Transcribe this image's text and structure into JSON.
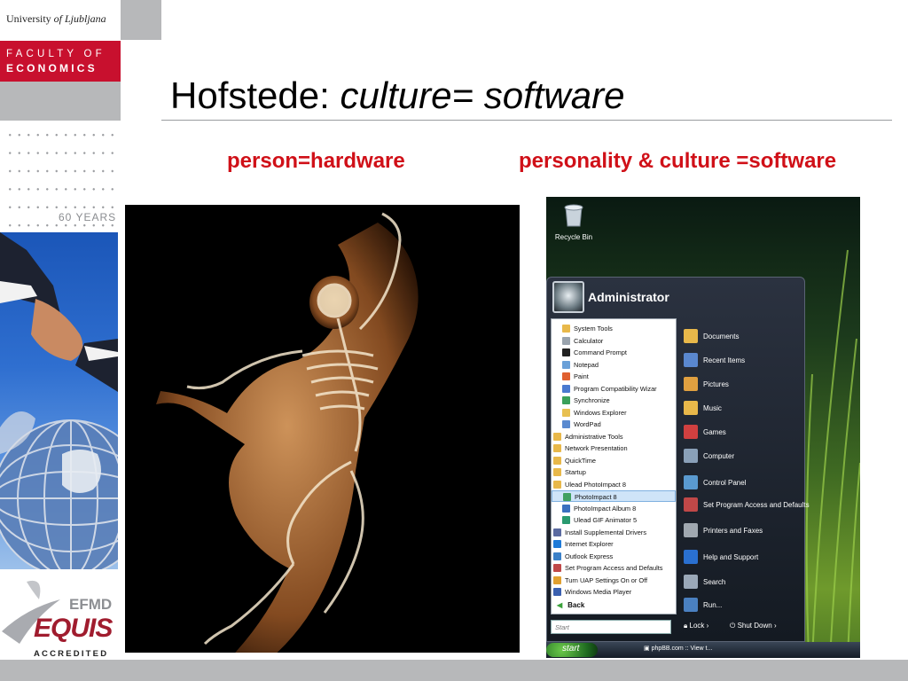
{
  "branding": {
    "university_prefix": "University",
    "university_name": "of Ljubljana",
    "faculty_line1": "FACULTY OF",
    "faculty_line2": "ECONOMICS",
    "anniversary": "60 YEARS",
    "accreditation_org": "EFMD",
    "accreditation_name": "EQUIS",
    "accreditation_status": "ACCREDITED",
    "brand_red": "#c8102e",
    "brand_grey": "#b7b8ba"
  },
  "slide": {
    "title_plain": "Hofstede: ",
    "title_italic": "culture= software",
    "left_heading": "person=hardware",
    "right_heading": "personality & culture =software",
    "heading_color": "#d01018"
  },
  "desktop": {
    "recycle_bin_label": "Recycle Bin",
    "user_name": "Administrator",
    "left_items": [
      {
        "label": "System Tools",
        "icon": "folder-icon",
        "indent": true
      },
      {
        "label": "Calculator",
        "icon": "calculator-icon",
        "indent": true
      },
      {
        "label": "Command Prompt",
        "icon": "terminal-icon",
        "indent": true
      },
      {
        "label": "Notepad",
        "icon": "notepad-icon",
        "indent": true
      },
      {
        "label": "Paint",
        "icon": "paint-icon",
        "indent": true
      },
      {
        "label": "Program Compatibility Wizar",
        "icon": "wizard-icon",
        "indent": true
      },
      {
        "label": "Synchronize",
        "icon": "sync-icon",
        "indent": true
      },
      {
        "label": "Windows Explorer",
        "icon": "explorer-icon",
        "indent": true
      },
      {
        "label": "WordPad",
        "icon": "wordpad-icon",
        "indent": true
      },
      {
        "label": "Administrative Tools",
        "icon": "folder-icon",
        "indent": false
      },
      {
        "label": "Network Presentation",
        "icon": "folder-icon",
        "indent": false
      },
      {
        "label": "QuickTime",
        "icon": "folder-icon",
        "indent": false
      },
      {
        "label": "Startup",
        "icon": "folder-icon",
        "indent": false
      },
      {
        "label": "Ulead PhotoImpact 8",
        "icon": "folder-icon",
        "indent": false
      },
      {
        "label": "PhotoImpact 8",
        "icon": "photoimpact-icon",
        "indent": true,
        "selected": true
      },
      {
        "label": "PhotoImpact Album 8",
        "icon": "album-icon",
        "indent": true
      },
      {
        "label": "Ulead GIF Animator 5",
        "icon": "gif-icon",
        "indent": true
      },
      {
        "label": "Install Supplemental Drivers",
        "icon": "driver-icon",
        "indent": false
      },
      {
        "label": "Internet Explorer",
        "icon": "ie-icon",
        "indent": false
      },
      {
        "label": "Outlook Express",
        "icon": "mail-icon",
        "indent": false
      },
      {
        "label": "Set Program Access and Defaults",
        "icon": "defaults-icon",
        "indent": false
      },
      {
        "label": "Turn UAP Settings On or Off",
        "icon": "shield-icon",
        "indent": false
      },
      {
        "label": "Windows Media Player",
        "icon": "media-icon",
        "indent": false
      }
    ],
    "back_label": "Back",
    "right_items": [
      {
        "label": "Documents",
        "icon": "documents-icon"
      },
      {
        "label": "Recent Items",
        "icon": "recent-icon"
      },
      {
        "label": "Pictures",
        "icon": "pictures-icon"
      },
      {
        "label": "Music",
        "icon": "music-icon"
      },
      {
        "label": "Games",
        "icon": "games-icon"
      },
      {
        "label": "Computer",
        "icon": "computer-icon"
      },
      {
        "label": "Control Panel",
        "icon": "control-panel-icon"
      },
      {
        "label": "Set Program Access and Defaults",
        "icon": "defaults-icon"
      },
      {
        "label": "Printers and Faxes",
        "icon": "printer-icon"
      },
      {
        "label": "Help and Support",
        "icon": "help-icon"
      },
      {
        "label": "Search",
        "icon": "search-icon"
      },
      {
        "label": "Run...",
        "icon": "run-icon"
      }
    ],
    "search_placeholder": "Start",
    "lock_label": "Lock",
    "shutdown_label": "Shut Down",
    "start_label": "start",
    "taskbar_item": "phpBB.com :: View t..."
  }
}
